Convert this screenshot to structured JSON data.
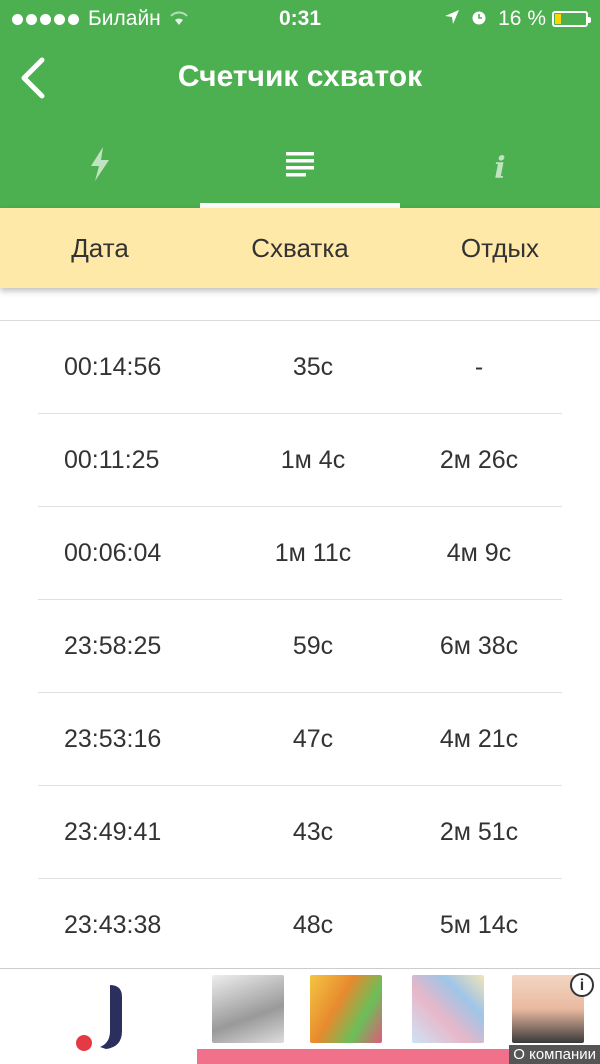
{
  "status_bar": {
    "carrier": "Билайн",
    "time": "0:31",
    "battery": "16 %",
    "battery_level": 0.16
  },
  "app_bar": {
    "title": "Счетчик схваток",
    "tabs": [
      {
        "icon": "lightning-icon",
        "active": false
      },
      {
        "icon": "list-icon",
        "active": true
      },
      {
        "icon": "info-icon",
        "active": false,
        "glyph": "i"
      }
    ]
  },
  "table": {
    "headers": [
      "Дата",
      "Схватка",
      "Отдых"
    ],
    "rows": [
      [
        "00:14:56",
        "35с",
        "-"
      ],
      [
        "00:11:25",
        "1м 4с",
        "2м 26с"
      ],
      [
        "00:06:04",
        "1м 11с",
        "4м 9с"
      ],
      [
        "23:58:25",
        "59с",
        "6м 38с"
      ],
      [
        "23:53:16",
        "47с",
        "4м 21с"
      ],
      [
        "23:49:41",
        "43с",
        "2м 51с"
      ],
      [
        "23:43:38",
        "48с",
        "5м 14с"
      ]
    ]
  },
  "ad": {
    "about": "О компании",
    "info_glyph": "i"
  },
  "colors": {
    "primary": "#4caf50",
    "header_bg": "#ffe9a8",
    "ad_bar": "#f07189"
  }
}
